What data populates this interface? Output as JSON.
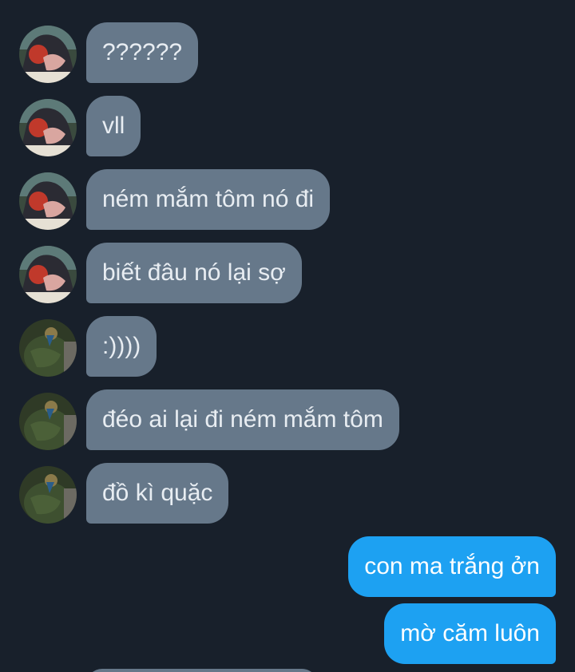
{
  "colors": {
    "background": "#18202b",
    "incoming_bubble": "#66788a",
    "outgoing_bubble": "#1da1f2",
    "incoming_text": "#e8edf2",
    "outgoing_text": "#ffffff"
  },
  "messages": [
    {
      "direction": "incoming",
      "sender": "user-a",
      "text": "??????"
    },
    {
      "direction": "incoming",
      "sender": "user-a",
      "text": "vll"
    },
    {
      "direction": "incoming",
      "sender": "user-a",
      "text": "ném mắm tôm nó đi"
    },
    {
      "direction": "incoming",
      "sender": "user-a",
      "text": "biết đâu nó lại sợ"
    },
    {
      "direction": "incoming",
      "sender": "user-b",
      "text": ":))))"
    },
    {
      "direction": "incoming",
      "sender": "user-b",
      "text": "đéo ai lại đi ném mắm tôm"
    },
    {
      "direction": "incoming",
      "sender": "user-b",
      "text": "đồ kì quặc"
    },
    {
      "direction": "outgoing",
      "sender": "me",
      "text": "con ma trắng ởn"
    },
    {
      "direction": "outgoing",
      "sender": "me",
      "text": "mờ căm luôn"
    }
  ],
  "avatars": {
    "user-a": {
      "icon": "anime-character-avatar-icon"
    },
    "user-b": {
      "icon": "green-figure-avatar-icon"
    }
  }
}
